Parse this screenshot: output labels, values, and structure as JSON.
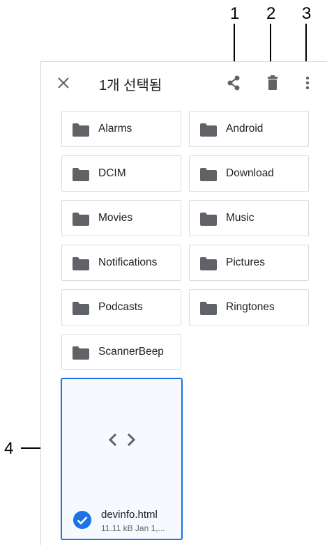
{
  "callouts": [
    "1",
    "2",
    "3",
    "4"
  ],
  "toolbar": {
    "title": "1개 선택됨",
    "close_icon": "close-icon",
    "share_icon": "share-icon",
    "delete_icon": "delete-icon",
    "more_icon": "more-vert-icon"
  },
  "folders": [
    {
      "name": "Alarms"
    },
    {
      "name": "Android"
    },
    {
      "name": "DCIM"
    },
    {
      "name": "Download"
    },
    {
      "name": "Movies"
    },
    {
      "name": "Music"
    },
    {
      "name": "Notifications"
    },
    {
      "name": "Pictures"
    },
    {
      "name": "Podcasts"
    },
    {
      "name": "Ringtones"
    },
    {
      "name": "ScannerBeep"
    }
  ],
  "file": {
    "name": "devinfo.html",
    "meta": "11.11 kB Jan 1,...",
    "selected": true,
    "icon": "code-icon"
  },
  "colors": {
    "accent": "#1a73e8",
    "folder_icon": "#5f6368",
    "border": "#dadce0"
  }
}
